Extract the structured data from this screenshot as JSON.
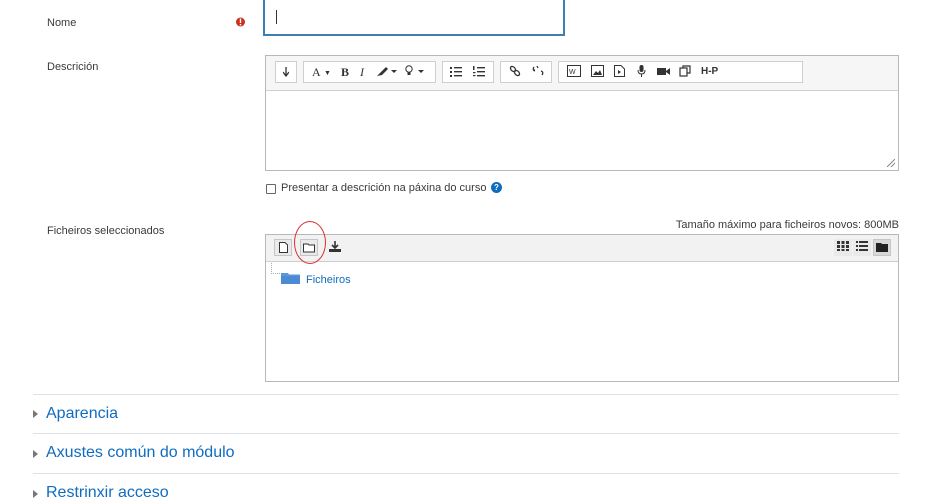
{
  "form": {
    "name_label": "Nome",
    "name_value": "",
    "description_label": "Descrición",
    "show_description_label": "Presentar a descrición na páxina do curso",
    "files_label": "Ficheiros seleccionados",
    "max_size_text": "Tamaño máximo para ficheiros novos: 800MB"
  },
  "editor_toolbar": {
    "buttons": [
      "collapse-toggle",
      "font-size",
      "bold",
      "italic",
      "text-color",
      "text-highlight",
      "bullet-list",
      "numbered-list",
      "link",
      "unlink",
      "equation",
      "image",
      "media",
      "record-audio",
      "record-video",
      "manage-files",
      "h5p"
    ],
    "labels": {
      "font_size": "A",
      "bold": "B",
      "italic": "I",
      "h5p": "H-P"
    }
  },
  "filemanager": {
    "folder_name": "Ficheiros",
    "toolbar_buttons": [
      "add-file",
      "create-folder",
      "download"
    ],
    "view_buttons": [
      "icons-view",
      "list-view",
      "tree-view"
    ]
  },
  "sections": [
    {
      "label": "Aparencia"
    },
    {
      "label": "Axustes común do módulo"
    },
    {
      "label": "Restrinxir acceso"
    }
  ],
  "colors": {
    "link": "#0f6cbf",
    "required": "#ca3120",
    "annotation": "#d9302f"
  }
}
